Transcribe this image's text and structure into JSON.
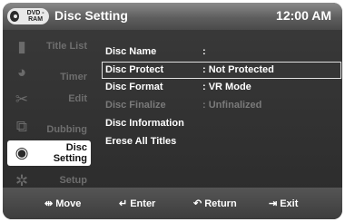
{
  "header": {
    "disc_badge": "DVD -RAM",
    "title": "Disc Setting",
    "clock": "12:00 AM"
  },
  "sidebar": {
    "items": [
      {
        "label": "Title List",
        "icon": "film-strip-icon"
      },
      {
        "label": "Timer",
        "icon": "clock-icon"
      },
      {
        "label": "Edit",
        "icon": "scissors-icon"
      },
      {
        "label": "Dubbing",
        "icon": "dubbing-icon"
      },
      {
        "label": "Disc Setting",
        "icon": "disc-icon"
      },
      {
        "label": "Setup",
        "icon": "gear-icon"
      }
    ],
    "active_index": 4
  },
  "menu": {
    "rows": [
      {
        "label": "Disc Name",
        "value": ":"
      },
      {
        "label": "Disc Protect",
        "value": ": Not Protected"
      },
      {
        "label": "Disc Format",
        "value": ": VR Mode"
      },
      {
        "label": "Disc Finalize",
        "value": ": Unfinalized"
      },
      {
        "label": "Disc Information",
        "value": ""
      },
      {
        "label": "Erese All Titles",
        "value": ""
      }
    ]
  },
  "footer": {
    "move": "Move",
    "enter": "Enter",
    "return": "Return",
    "exit": "Exit"
  }
}
